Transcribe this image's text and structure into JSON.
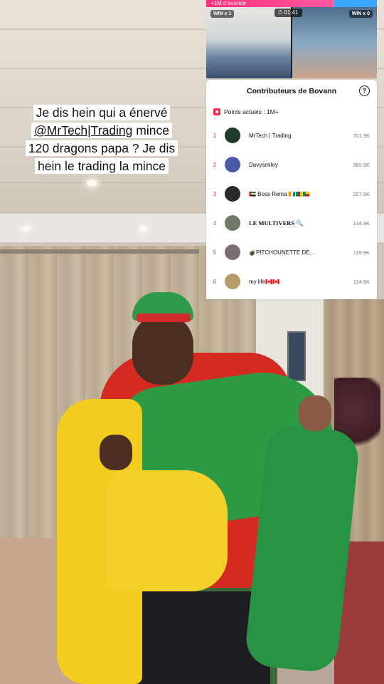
{
  "caption": {
    "line1": "Je dis hein qui a énervé",
    "mention": "@MrTech|Trading",
    "line2_rest": " mince",
    "line3": "120 dragons papa ? Je dis",
    "line4": "hein le trading la mince"
  },
  "battle": {
    "bar_label": "+1M d'avance",
    "left_badge": "WIN x 1",
    "timer": "01:41",
    "right_badge": "WIN x 0"
  },
  "panel": {
    "title": "Contributeurs de Bovann",
    "help_icon": "?",
    "points_label": "Points actuels : 1M+",
    "contributors": [
      {
        "rank": "1",
        "name": "MrTech | Trading",
        "score": "701.9K",
        "avatar_color": "#1f3b2a"
      },
      {
        "rank": "2",
        "name": "Davysmiley",
        "score": "380.9K",
        "avatar_color": "#4b5aa8"
      },
      {
        "rank": "3",
        "name": "🇦🇪 Boss Rema 🇨🇮🇨🇲🇧🇯",
        "score": "227.9K",
        "avatar_color": "#2a2a2a"
      },
      {
        "rank": "4",
        "name": "LE MULTIVERS 🔍",
        "score": "134.9K",
        "avatar_color": "#6c7a66"
      },
      {
        "rank": "5",
        "name": "💣PITCHOUNETTE DE...",
        "score": "119.9K",
        "avatar_color": "#7a6e73"
      },
      {
        "rank": "6",
        "name": "my life🇨🇦🇨🇦",
        "score": "114.9K",
        "avatar_color": "#b89a68"
      }
    ]
  },
  "colors": {
    "accent": "#fe2c55",
    "rank_top": "#fe2c55",
    "rank_other": "#777777"
  }
}
